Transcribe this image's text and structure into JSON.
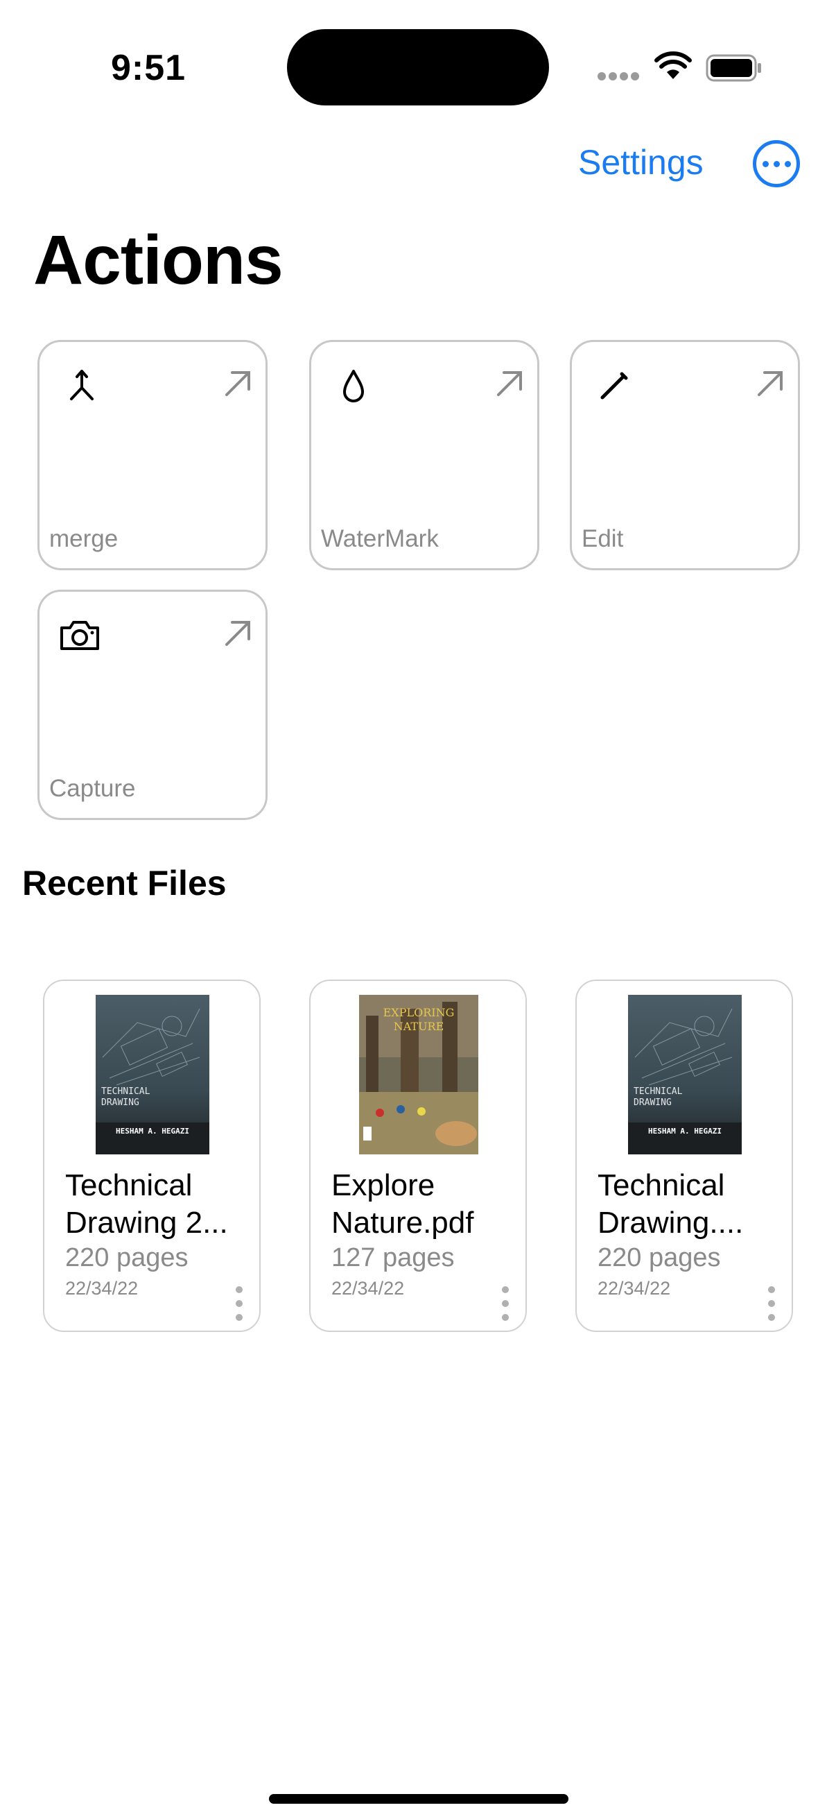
{
  "status_bar": {
    "time": "9:51"
  },
  "nav": {
    "settings_label": "Settings",
    "more_icon": "ellipsis-circle-icon"
  },
  "page_title": "Actions",
  "actions": [
    {
      "label": "merge",
      "icon": "merge-icon"
    },
    {
      "label": "WaterMark",
      "icon": "drop-icon"
    },
    {
      "label": "Edit",
      "icon": "pencil-icon"
    },
    {
      "label": "Capture",
      "icon": "camera-icon"
    }
  ],
  "recent_title": "Recent Files",
  "files": [
    {
      "name": "Technical Drawing 2...",
      "pages": "220 pages",
      "date": "22/34/22",
      "cover_title": "TECHNICAL DRAWING",
      "cover_author": "HESHAM A. HEGAZI"
    },
    {
      "name": "Explore Nature.pdf",
      "pages": "127 pages",
      "date": "22/34/22",
      "cover_title": "EXPLORING NATURE"
    },
    {
      "name": "Technical Drawing....",
      "pages": "220 pages",
      "date": "22/34/22",
      "cover_title": "TECHNICAL DRAWING",
      "cover_author": "HESHAM A. HEGAZI"
    }
  ],
  "colors": {
    "accent": "#1a7cf0",
    "muted": "#8a8a8a",
    "border": "#c8c8c8"
  }
}
